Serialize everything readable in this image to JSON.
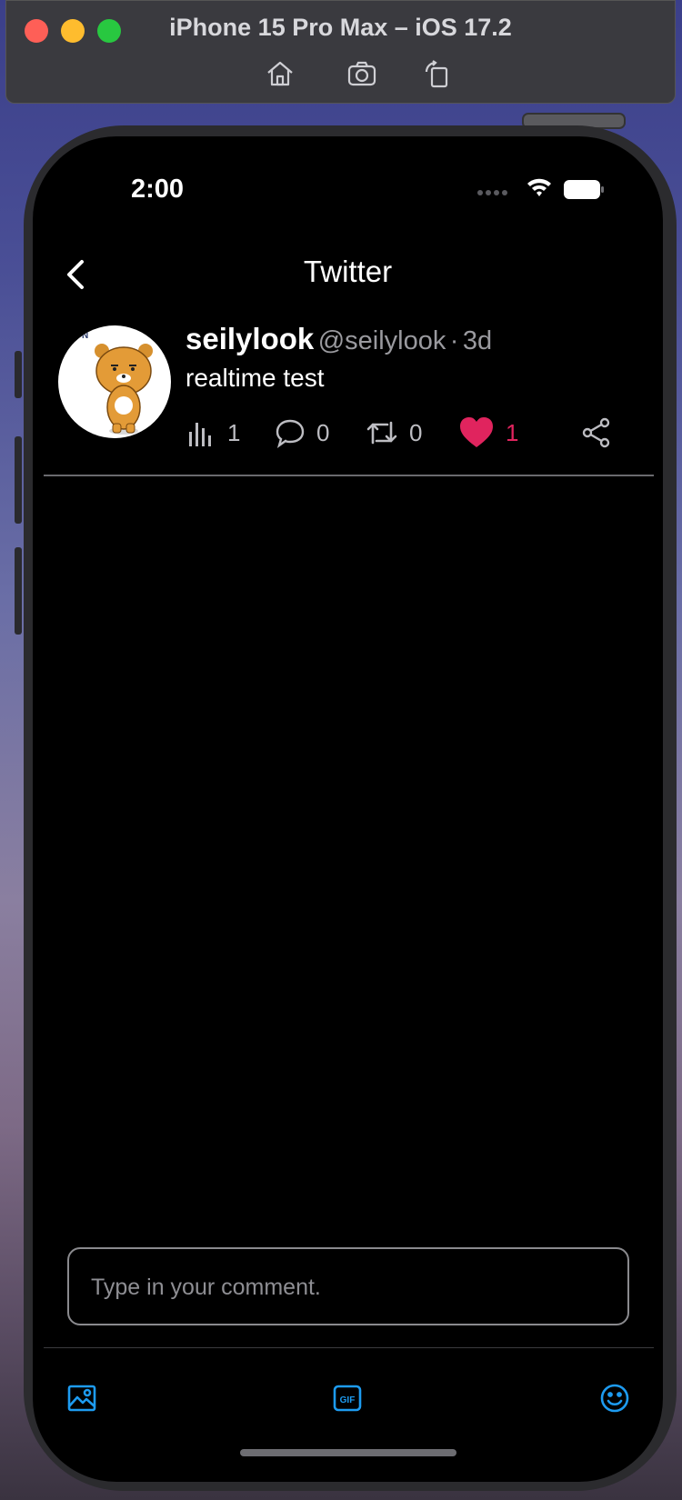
{
  "simulator": {
    "title": "iPhone 15 Pro Max – iOS 17.2",
    "tools": [
      "home-icon",
      "screenshot-icon",
      "rotate-icon"
    ]
  },
  "status_bar": {
    "time": "2:00",
    "icons": [
      "signal-dots-icon",
      "wifi-icon",
      "battery-icon"
    ]
  },
  "nav": {
    "title": "Twitter",
    "back_icon": "chevron-left-icon"
  },
  "tweet": {
    "username": "seilylook",
    "handle": "@seilylook",
    "separator": "·",
    "time": "3d",
    "text": "realtime test",
    "avatar": "bear-avatar",
    "actions": {
      "views": "1",
      "comments": "0",
      "retweets": "0",
      "likes": "1",
      "liked": true
    }
  },
  "comment": {
    "placeholder": "Type in your comment.",
    "value": ""
  },
  "toolbar": {
    "items": [
      "image-icon",
      "gif-icon",
      "emoji-icon"
    ]
  },
  "colors": {
    "background": "#000000",
    "accent_blue": "#1d9bf0",
    "like_pink": "#e0245e",
    "muted": "#9a9a9f"
  }
}
